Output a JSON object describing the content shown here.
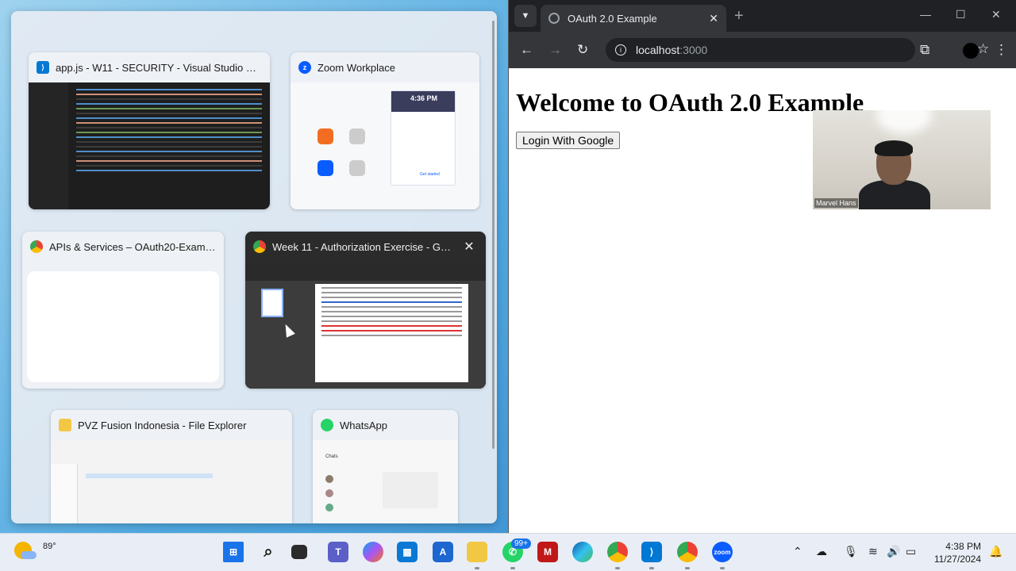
{
  "snap_assist": {
    "windows": [
      {
        "title": "app.js - W11 - SECURITY - Visual Studio Code",
        "icon": "vscode-icon"
      },
      {
        "title": "Zoom Workplace",
        "icon": "zoom-icon",
        "preview_time": "4:36 PM",
        "preview_button": "Get started"
      },
      {
        "title": "APIs & Services – OAuth20-Example...",
        "icon": "chrome-icon"
      },
      {
        "title": "Week 11 - Authorization Exercise - Goo...",
        "icon": "chrome-icon",
        "close_glyph": "✕"
      },
      {
        "title": "PVZ Fusion Indonesia - File Explorer",
        "icon": "folder-icon"
      },
      {
        "title": "WhatsApp",
        "icon": "whatsapp-icon",
        "preview_header": "Chats"
      }
    ]
  },
  "browser": {
    "tab_title": "OAuth 2.0 Example",
    "url_host": "localhost",
    "url_port": ":3000",
    "page_heading": "Welcome to OAuth 2.0 Example",
    "login_button": "Login With Google"
  },
  "webcam": {
    "name": "Marvel Hans"
  },
  "taskbar": {
    "temperature": "89°",
    "notification_badge": "99+",
    "time": "4:38 PM",
    "date": "11/27/2024"
  },
  "colors": {
    "chrome_dark": "#202124",
    "chrome_toolbar": "#35363a",
    "vscode_blue": "#0078d4",
    "zoom_blue": "#0b5cff",
    "whatsapp_green": "#25d366"
  }
}
